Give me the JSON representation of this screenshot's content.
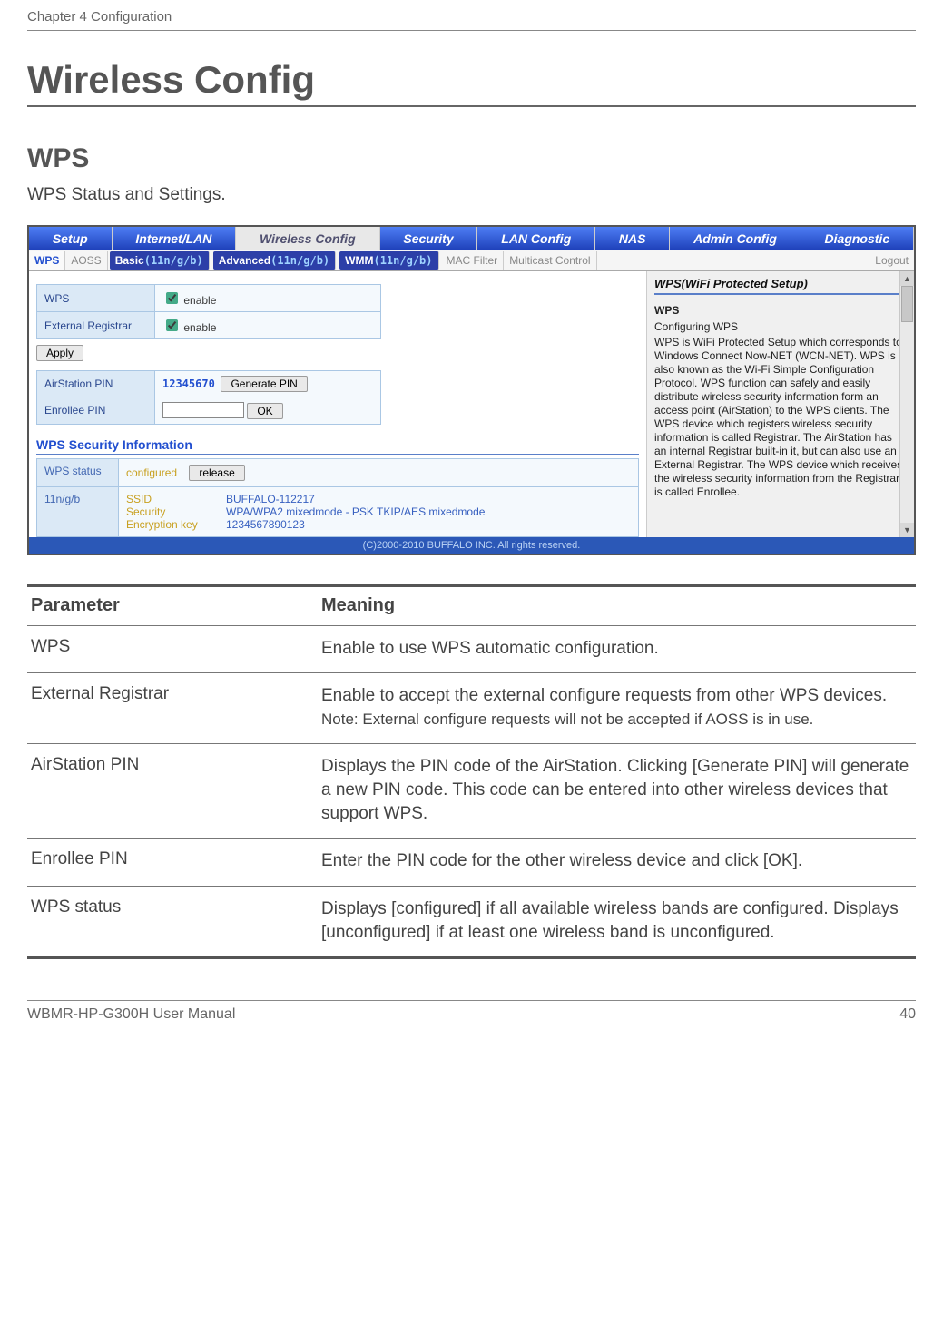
{
  "chapter": "Chapter 4  Configuration",
  "page_title": "Wireless Config",
  "section": "WPS",
  "section_desc": "WPS Status and Settings.",
  "footer_model": "WBMR-HP-G300H User Manual",
  "footer_page": "40",
  "shot": {
    "main_tabs": [
      "Setup",
      "Internet/LAN",
      "Wireless Config",
      "Security",
      "LAN Config",
      "NAS",
      "Admin Config",
      "Diagnostic"
    ],
    "main_active_index": 2,
    "sub": {
      "wps": "WPS",
      "aoss": "AOSS",
      "basic": "Basic",
      "basic_band": "(11n/g/b)",
      "advanced": "Advanced",
      "advanced_band": "(11n/g/b)",
      "wmm": "WMM",
      "wmm_band": "(11n/g/b)",
      "mac": "MAC Filter",
      "multicast": "Multicast Control",
      "logout": "Logout"
    },
    "cfg": {
      "wps_label": "WPS",
      "enable_text": "enable",
      "extreg_label": "External Registrar",
      "apply": "Apply",
      "airpin_label": "AirStation PIN",
      "airpin_value": "12345670",
      "genpin": "Generate PIN",
      "enrollee_label": "Enrollee PIN",
      "ok": "OK"
    },
    "secinfo": {
      "title": "WPS Security Information",
      "status_label": "WPS status",
      "status_value": "configured",
      "release": "release",
      "band": "11n/g/b",
      "ssid_lbl": "SSID",
      "sec_lbl": "Security",
      "enc_lbl": "Encryption key",
      "ssid_val": "BUFFALO-112217",
      "sec_val": "WPA/WPA2 mixedmode - PSK TKIP/AES mixedmode",
      "enc_val": "1234567890123"
    },
    "help": {
      "title": "WPS(WiFi Protected Setup)",
      "sub": "WPS",
      "l1": "Configuring WPS",
      "body": "WPS is WiFi Protected Setup which corresponds to Windows Connect Now-NET (WCN-NET). WPS is also known as the Wi-Fi Simple Configuration Protocol. WPS function can safely and easily distribute wireless security information form an access point (AirStation) to the WPS clients. The WPS device which registers wireless security information is called Registrar. The AirStation has an internal Registrar built-in it, but can also use an External Registrar. The WPS device which receives the wireless security information from the Registrar is called Enrollee."
    },
    "copyright": "(C)2000-2010 BUFFALO INC. All rights reserved."
  },
  "param_table": {
    "h1": "Parameter",
    "h2": "Meaning",
    "rows": [
      {
        "p": "WPS",
        "m": "Enable to use WPS automatic configuration."
      },
      {
        "p": "External Registrar",
        "m": "Enable to accept the external configure requests from other WPS devices.",
        "note": "Note:  External configure requests will not be accepted if AOSS is in use."
      },
      {
        "p": "AirStation PIN",
        "m": "Displays the PIN code of the AirStation. Clicking [Generate PIN] will generate a new PIN code. This code can be entered into other wireless devices that support WPS."
      },
      {
        "p": "Enrollee PIN",
        "m": "Enter the PIN code for the other wireless device and click [OK]."
      },
      {
        "p": "WPS status",
        "m": "Displays [configured] if all available wireless bands are configured.  Displays [unconfigured] if at least one wireless band is unconfigured."
      }
    ]
  }
}
